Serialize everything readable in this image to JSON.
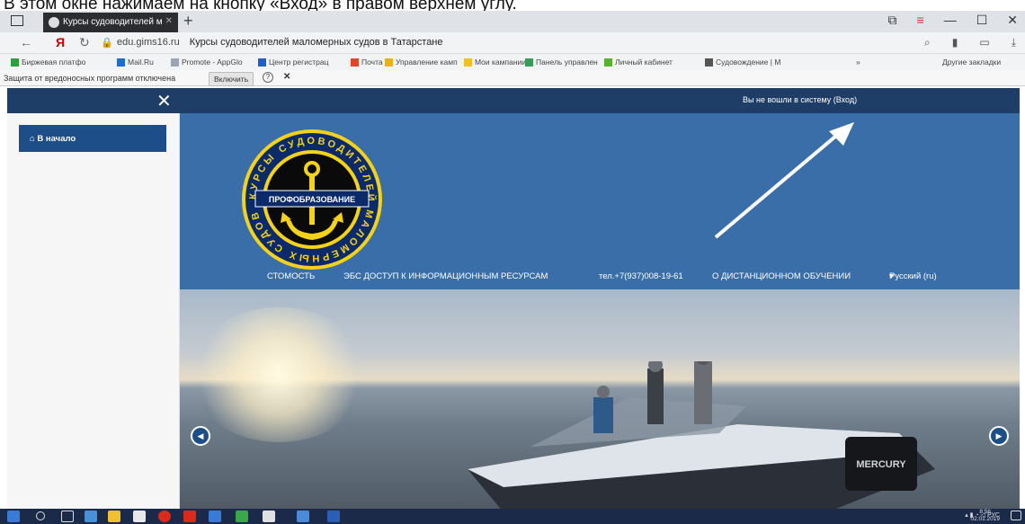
{
  "caption": "В этом окне нажимаем на кнопку «Вход» в правом верхнем углу.",
  "browser": {
    "tab_title": "Курсы судоводителей м",
    "domain": "edu.gims16.ru",
    "page_title": "Курсы судоводителей маломерных судов в Татарстане",
    "bookmarks": [
      {
        "label": "Биржевая платфо",
        "color": "#2e9e3e"
      },
      {
        "label": "Mail.Ru",
        "color": "#1f6fc6"
      },
      {
        "label": "Promote - AppGlo",
        "color": "#9aa6b2"
      },
      {
        "label": "Центр регистрац",
        "color": "#1f5fc6"
      },
      {
        "label": "Почта",
        "color": "#d94a2a"
      },
      {
        "label": "Управление камп",
        "color": "#e8b21a"
      },
      {
        "label": "Мои кампании",
        "color": "#f0c020"
      },
      {
        "label": "Панель управлен",
        "color": "#3a9a5a"
      },
      {
        "label": "Личный кабинет",
        "color": "#5ab030"
      },
      {
        "label": "Судовождение | М",
        "color": "#555555"
      }
    ],
    "bookmarks_more": "»",
    "other_bookmarks": "Другие закладки",
    "infobar_text": "Защита от вредоносных программ отключена",
    "infobar_button": "Включить",
    "help_glyph": "?",
    "close_glyph": "✕"
  },
  "site": {
    "close_glyph": "✕",
    "login_status": "Вы не вошли в систему (Вход)",
    "home_label": "В начало",
    "logo": {
      "ring_text": "КУРСЫ СУДОВОДИТЕЛЕЙ МАЛОМЕРНЫХ СУДОВ",
      "banner": "ПРОФОБРАЗОВАНИЕ"
    },
    "menu": [
      "СТОМОСТЬ",
      "ЭБС ДОСТУП К ИНФОРМАЦИОННЫМ РЕСУРСАМ",
      "тел.+7(937)008-19-61",
      "О ДИСТАНЦИОННОМ ОБУЧЕНИИ",
      "Русский (ru)"
    ],
    "menu_dropdown": "▾",
    "motor_brand": "MERCURY"
  },
  "taskbar": {
    "lang": "РУС",
    "time": "8:56",
    "date": "02.01.2019"
  },
  "colors": {
    "header_bar": "#1e3e68",
    "hero": "#3a6ea8",
    "nav_button": "#1e4e88"
  }
}
